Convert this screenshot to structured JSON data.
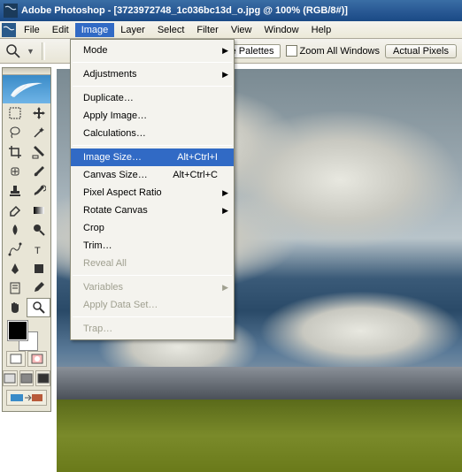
{
  "title": "Adobe Photoshop - [3723972748_1c036bc13d_o.jpg @ 100% (RGB/8#)]",
  "menubar": {
    "file": "File",
    "edit": "Edit",
    "image": "Image",
    "layer": "Layer",
    "select": "Select",
    "filter": "Filter",
    "view": "View",
    "window": "Window",
    "help": "Help"
  },
  "optbar": {
    "more_palettes": "ore Palettes",
    "zoom_all": "Zoom All Windows",
    "actual_pixels": "Actual Pixels"
  },
  "dropdown": {
    "mode": "Mode",
    "adjustments": "Adjustments",
    "duplicate": "Duplicate…",
    "apply_image": "Apply Image…",
    "calculations": "Calculations…",
    "image_size": "Image Size…",
    "image_size_sc": "Alt+Ctrl+I",
    "canvas_size": "Canvas Size…",
    "canvas_size_sc": "Alt+Ctrl+C",
    "pixel_ar": "Pixel Aspect Ratio",
    "rotate_canvas": "Rotate Canvas",
    "crop": "Crop",
    "trim": "Trim…",
    "reveal_all": "Reveal All",
    "variables": "Variables",
    "apply_data": "Apply Data Set…",
    "trap": "Trap…"
  }
}
